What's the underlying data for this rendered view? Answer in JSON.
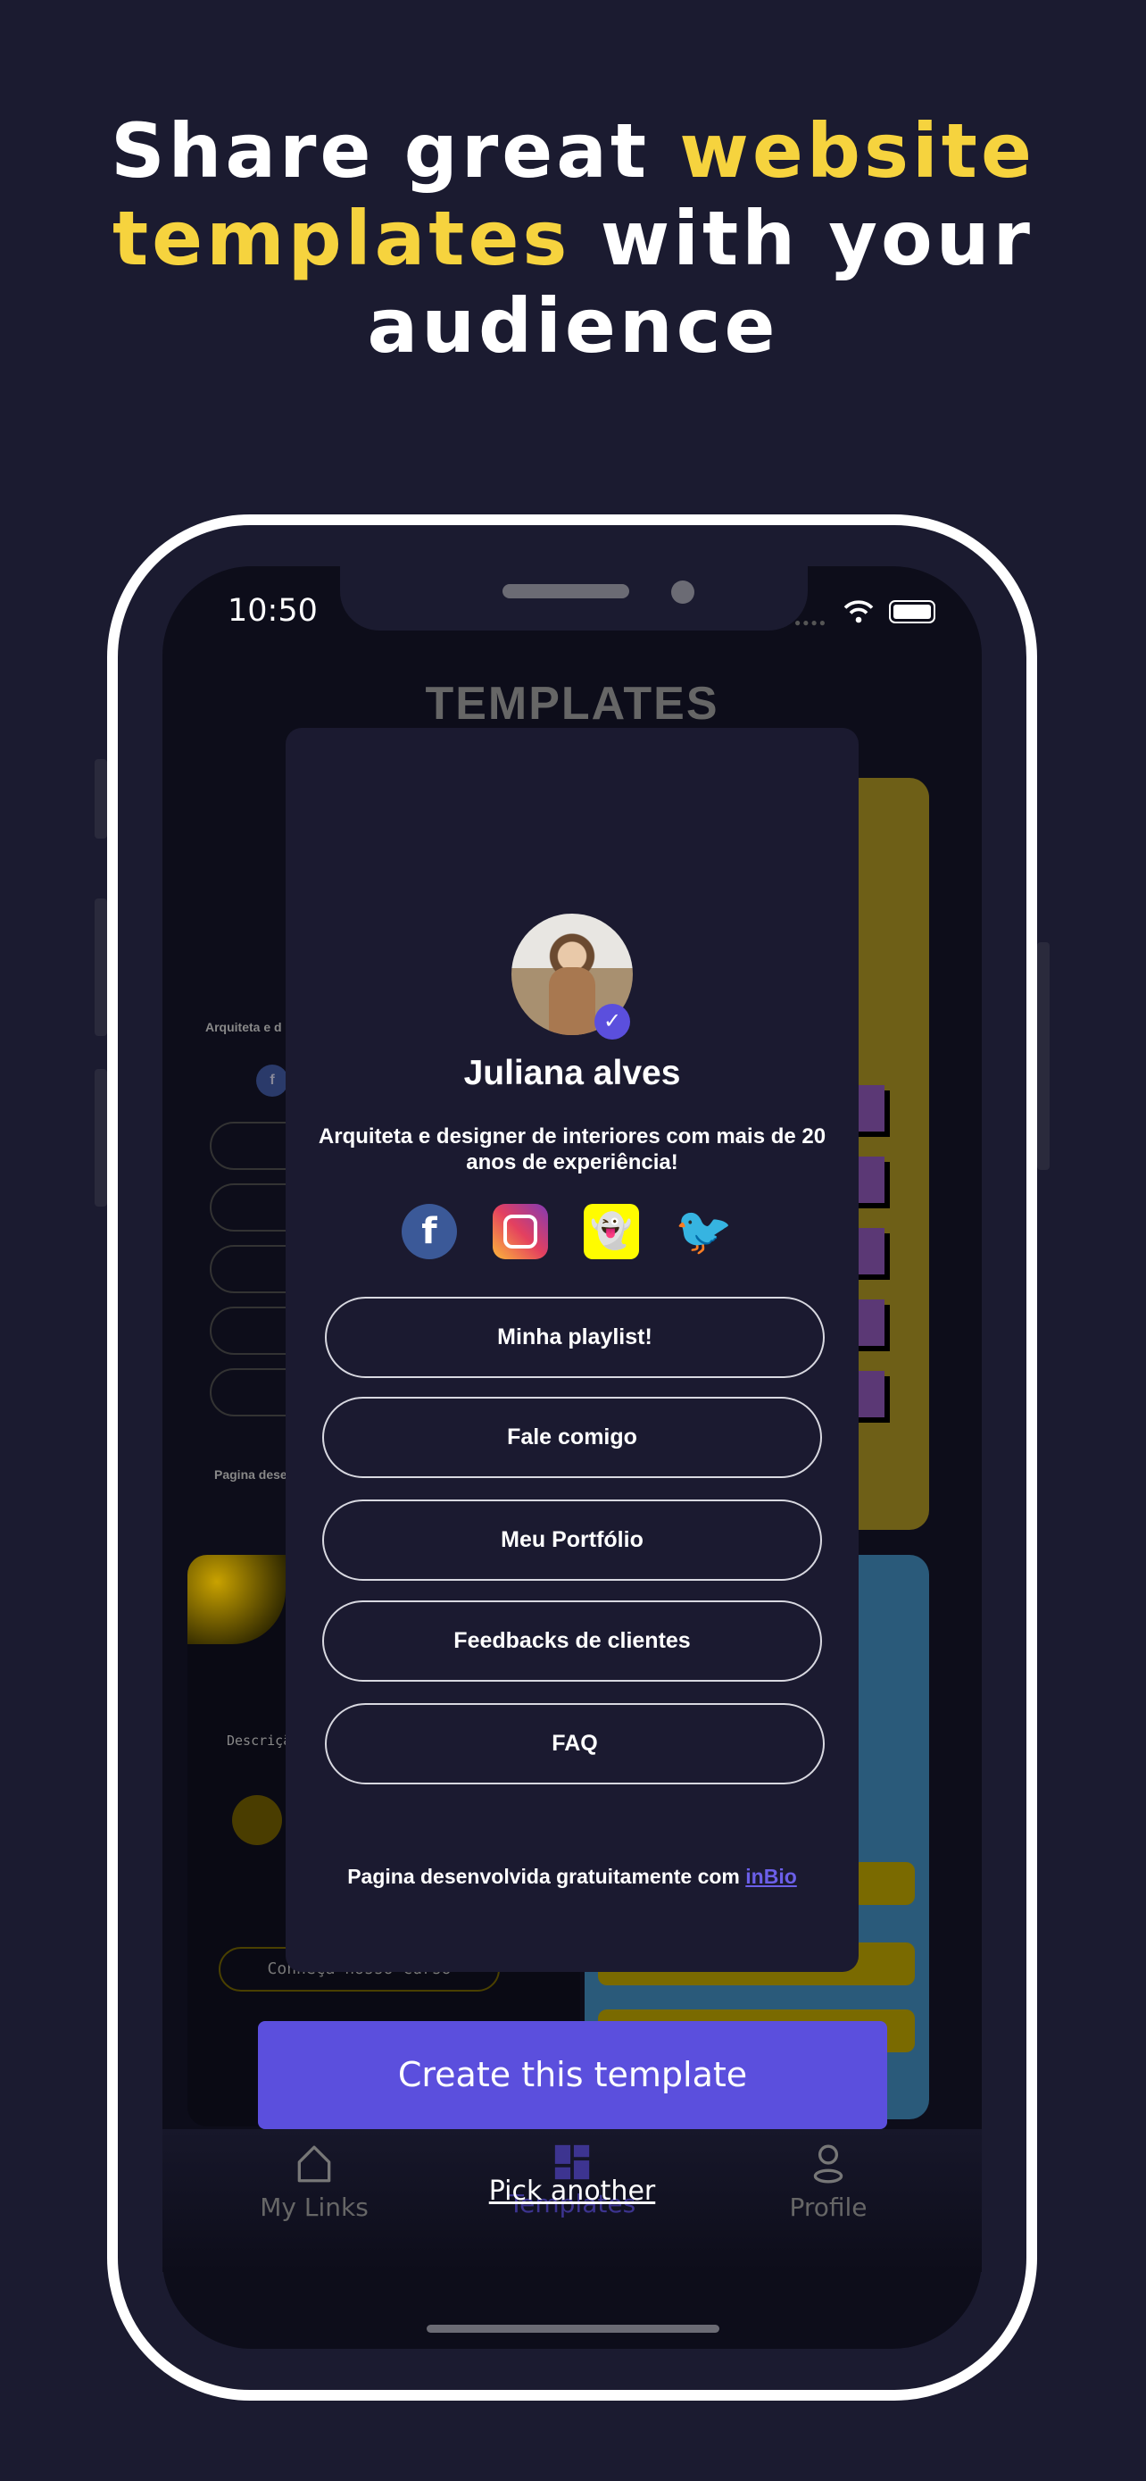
{
  "headline": {
    "part1": "Share great ",
    "highlight1": "website",
    "highlight2": "templates",
    "part2": " with your",
    "part3": "audience"
  },
  "status_bar": {
    "time": "10:50"
  },
  "screen_title": "TEMPLATES",
  "preview": {
    "name": "Juliana alves",
    "bio": "Arquiteta e designer de interiores com mais de 20 anos de experiência!",
    "socials": [
      "facebook-icon",
      "instagram-icon",
      "snapchat-icon",
      "twitter-icon"
    ],
    "links": [
      "Minha playlist!",
      "Fale comigo",
      "Meu Portfólio",
      "Feedbacks de clientes",
      "FAQ"
    ],
    "footer_text": "Pagina desenvolvida gratuitamente com ",
    "footer_link": "inBio"
  },
  "background_fragments": {
    "left_bio": "Arquiteta e d",
    "left_footer": "Pagina dese",
    "left2_desc": "Descriçã seu per",
    "left2_button": "Conheça nosso curso"
  },
  "actions": {
    "create": "Create this template",
    "pick_another": "Pick another"
  },
  "tabs": [
    {
      "label": "My Links"
    },
    {
      "label": "Templates"
    },
    {
      "label": "Profile"
    }
  ],
  "colors": {
    "accent": "#5b4fdd",
    "highlight": "#f6d33e",
    "background": "#1b1b30"
  }
}
